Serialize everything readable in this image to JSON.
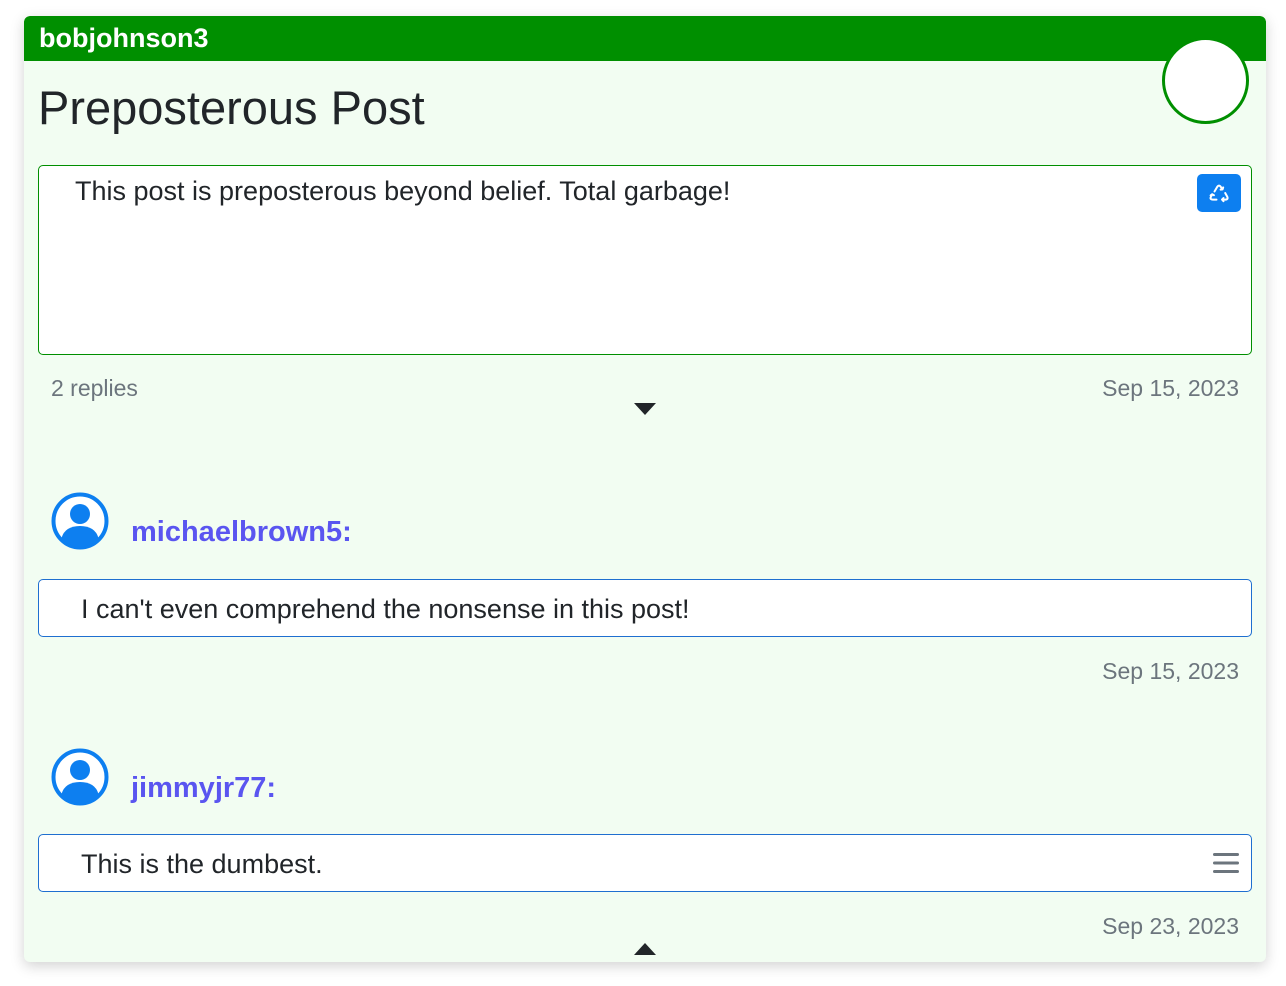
{
  "post": {
    "author": "bobjohnson3",
    "title": "Preposterous Post",
    "body": "This post is preposterous beyond belief. Total garbage!",
    "replies_count": "2 replies",
    "date": "Sep 15, 2023",
    "recycle_icon": "recycle-icon",
    "expand_icon": "caret-down-icon"
  },
  "replies": [
    {
      "author": "michaelbrown5:",
      "text": "I can't even comprehend the nonsense in this post!",
      "date": "Sep 15, 2023",
      "avatar_icon": "user-circle-icon"
    },
    {
      "author": "jimmyjr77:",
      "text": "This is the dumbest.",
      "date": "Sep 23, 2023",
      "avatar_icon": "user-circle-icon",
      "menu_icon": "hamburger-menu-icon"
    }
  ],
  "collapse_icon": "caret-up-icon",
  "colors": {
    "header_green": "#008f00",
    "card_bg": "#f2fdf2",
    "author_purple": "#5a55f0",
    "avatar_blue": "#0d7ff0",
    "reply_border": "#1f6fd0"
  }
}
